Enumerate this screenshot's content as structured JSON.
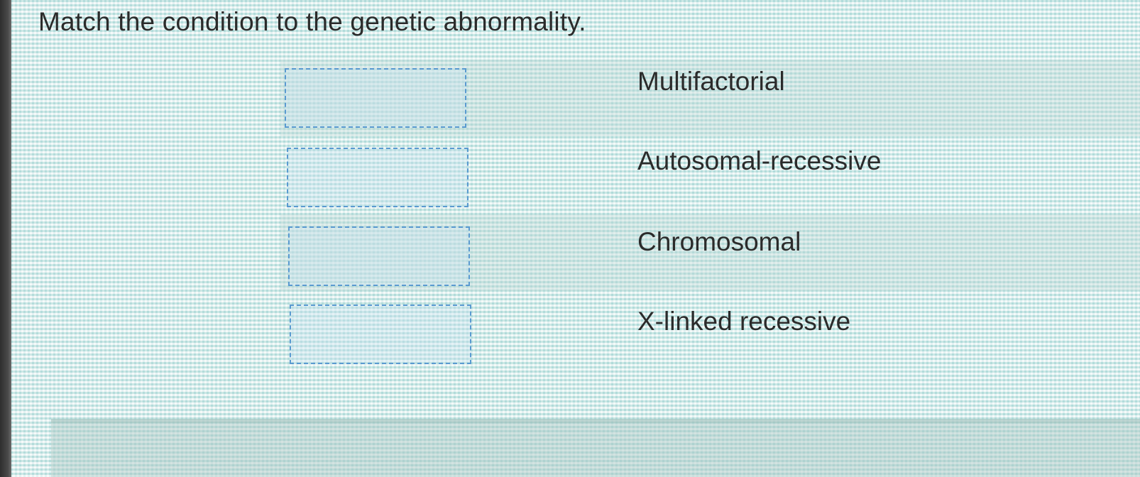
{
  "question": {
    "text": "Match the condition to the genetic abnormality."
  },
  "matching": {
    "drop_targets": [
      {
        "value": ""
      },
      {
        "value": ""
      },
      {
        "value": ""
      },
      {
        "value": ""
      }
    ],
    "terms": [
      {
        "label": "Multifactorial"
      },
      {
        "label": "Autosomal-recessive"
      },
      {
        "label": "Chromosomal"
      },
      {
        "label": "X-linked recessive"
      }
    ]
  },
  "colors": {
    "text": "#2b2b2b",
    "drop_border": "#5a9ad0",
    "background": "#cfe6e1"
  }
}
